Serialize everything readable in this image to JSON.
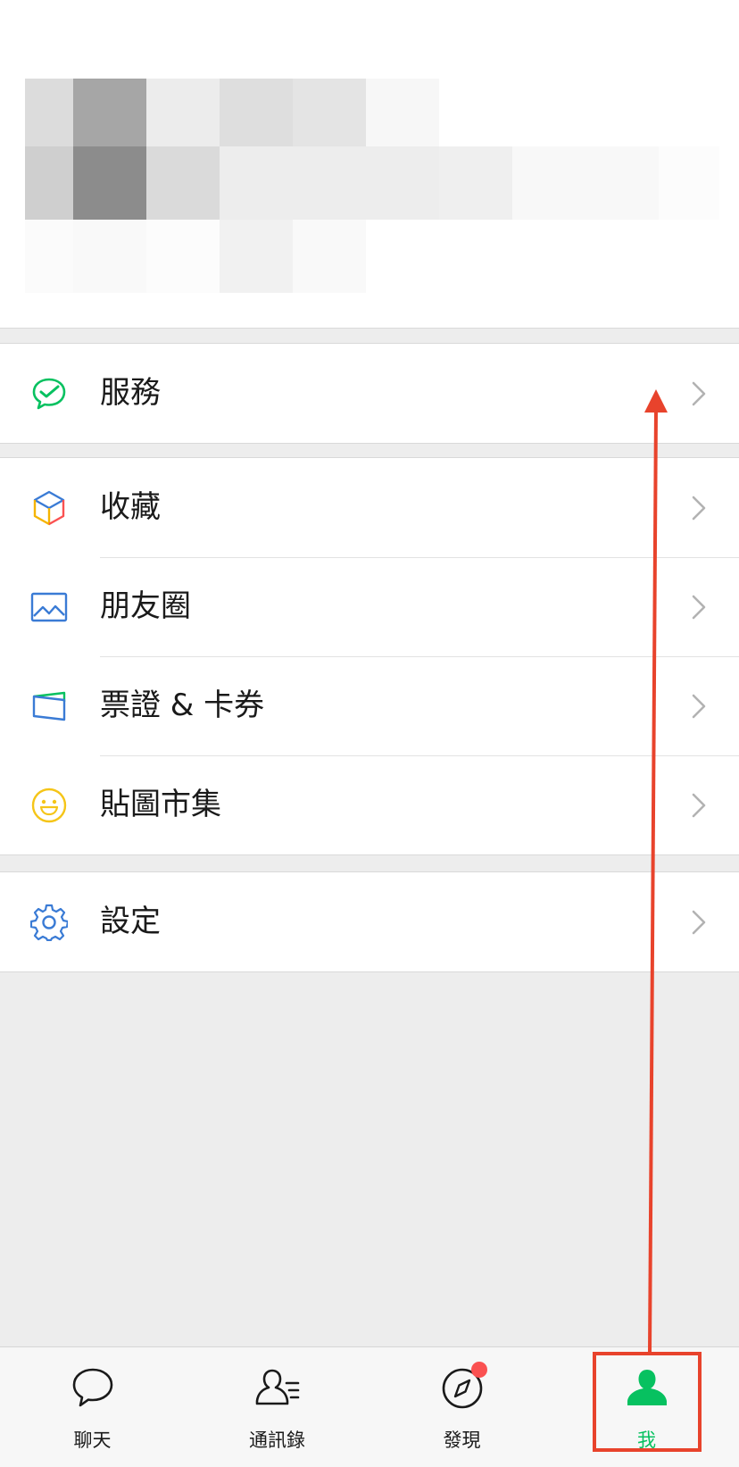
{
  "profile": {
    "redacted": true
  },
  "menu_groups": [
    {
      "items": [
        {
          "label": "服務",
          "icon": "services-icon",
          "color": "#07c160"
        }
      ]
    },
    {
      "items": [
        {
          "label": "收藏",
          "icon": "favorites-icon",
          "color": "#f0a030"
        },
        {
          "label": "朋友圈",
          "icon": "moments-icon",
          "color": "#3a7bd5"
        },
        {
          "label": "票證 & 卡券",
          "icon": "cards-icon",
          "color": "#3a7bd5"
        },
        {
          "label": "貼圖市集",
          "icon": "sticker-icon",
          "color": "#f5c518"
        }
      ]
    },
    {
      "items": [
        {
          "label": "設定",
          "icon": "settings-icon",
          "color": "#3a7bd5"
        }
      ]
    }
  ],
  "tabbar": {
    "tabs": [
      {
        "label": "聊天",
        "icon": "chat-icon"
      },
      {
        "label": "通訊錄",
        "icon": "contacts-icon"
      },
      {
        "label": "發現",
        "icon": "discover-icon",
        "badge": "dot"
      },
      {
        "label": "我",
        "icon": "me-icon",
        "active": true
      }
    ],
    "active_color": "#07c160"
  },
  "annotation": {
    "color": "#e8432c",
    "type": "arrow-from-tab-to-services"
  }
}
